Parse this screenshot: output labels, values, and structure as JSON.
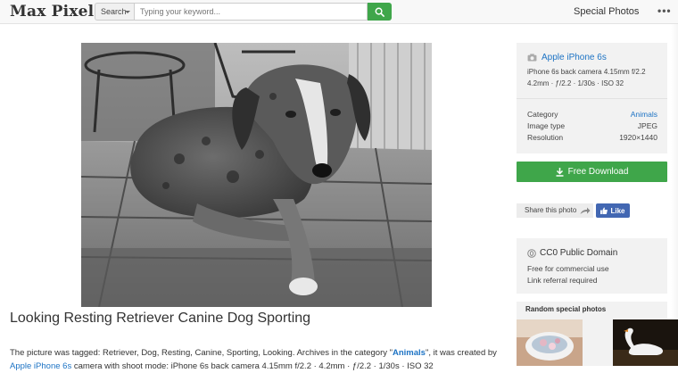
{
  "header": {
    "logo": "Max Pixel",
    "search_select_label": "Search",
    "search_placeholder": "Typing your keyword...",
    "nav_special": "Special Photos",
    "nav_more": "•••"
  },
  "main": {
    "title": "Looking Resting Retriever Canine Dog Sporting",
    "desc_prefix": "The picture was tagged: Retriever, Dog, Resting, Canine, Sporting, Looking. Archives in the category \"",
    "desc_category": "Animals",
    "desc_middle": "\", it was created by ",
    "desc_camera": "Apple iPhone 6s",
    "desc_suffix": " camera with shoot mode: iPhone 6s back camera 4.15mm f/2.2 · 4.2mm · ƒ/2.2 · 1/30s · ISO 32"
  },
  "sidebar": {
    "camera_name": "Apple iPhone 6s",
    "camera_lens": "iPhone 6s back camera 4.15mm f/2.2",
    "camera_settings": "4.2mm · ƒ/2.2 · 1/30s · ISO 32",
    "info": [
      {
        "label": "Category",
        "value": "Animals"
      },
      {
        "label": "Image type",
        "value": "JPEG"
      },
      {
        "label": "Resolution",
        "value": "1920×1440"
      }
    ],
    "download_label": "Free Download",
    "share_label": "Share this photo",
    "like_label": "Like",
    "license_title": "CC0 Public Domain",
    "license_line1": "Free for commercial use",
    "license_line2": "Link referral required",
    "random_title": "Random special photos"
  },
  "colors": {
    "accent_green": "#3fa64a",
    "link_blue": "#1d73c4",
    "facebook_blue": "#4267b2"
  }
}
